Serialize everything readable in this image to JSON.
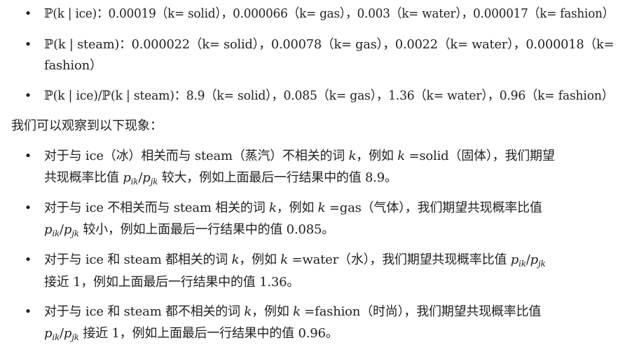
{
  "list1": [
    {
      "lines": [
        "ℙ(k | ice)：0.00019（k= solid），0.000066（k= gas），0.003（k= water），0.000017（k= fashion）"
      ]
    },
    {
      "lines": [
        "ℙ(k | steam)：0.000022（k= solid），0.00078（k= gas），0.0022（k= water），0.000018（k=",
        "fashion）"
      ]
    },
    {
      "lines": [
        "ℙ(k | ice)/ℙ(k | steam)：8.9（k= solid），0.085（k= gas），1.36（k= water），0.96（k= fashion）"
      ]
    }
  ],
  "paragraph": "我们可以观察到以下现象：",
  "list2": [
    {
      "line1_a": "对于与 ice（冰）相关而与 steam（蒸汽）不相关的词 ",
      "line1_var": "k",
      "line1_b": "，例如 ",
      "line1_var2": "k",
      "line1_c": " =solid（固体），我们期望",
      "line2_a": "共现概率比值 ",
      "ratio_p1": "p",
      "ratio_s1": "ik",
      "ratio_slash": "/",
      "ratio_p2": "p",
      "ratio_s2": "jk",
      "line2_b": " 较大，例如上面最后一行结果中的值 8.9。"
    },
    {
      "line1_a": "对于与 ice 不相关而与 steam 相关的词 ",
      "line1_var": "k",
      "line1_b": "，例如 ",
      "line1_var2": "k",
      "line1_c": " =gas（气体），我们期望共现概率比值",
      "ratio_p1": "p",
      "ratio_s1": "ik",
      "ratio_slash": "/",
      "ratio_p2": "p",
      "ratio_s2": "jk",
      "line2_b": " 较小，例如上面最后一行结果中的值 0.085。"
    },
    {
      "line1_a": "对于与 ice 和 steam 都相关的词 ",
      "line1_var": "k",
      "line1_b": "，例如 ",
      "line1_var2": "k",
      "line1_c": " =water（水），我们期望共现概率比值 ",
      "ratio_p1": "p",
      "ratio_s1": "ik",
      "ratio_slash": "/",
      "ratio_p2": "p",
      "ratio_s2": "jk",
      "line2_b": "接近 1，例如上面最后一行结果中的值 1.36。"
    },
    {
      "line1_a": "对于与 ice 和 steam 都不相关的词 ",
      "line1_var": "k",
      "line1_b": "，例如 ",
      "line1_var2": "k",
      "line1_c": " =fashion（时尚），我们期望共现概率比值",
      "ratio_p1": "p",
      "ratio_s1": "ik",
      "ratio_slash": "/",
      "ratio_p2": "p",
      "ratio_s2": "jk",
      "line2_b": " 接近 1，例如上面最后一行结果中的值 0.96。"
    }
  ],
  "bullet_glyph": "•"
}
